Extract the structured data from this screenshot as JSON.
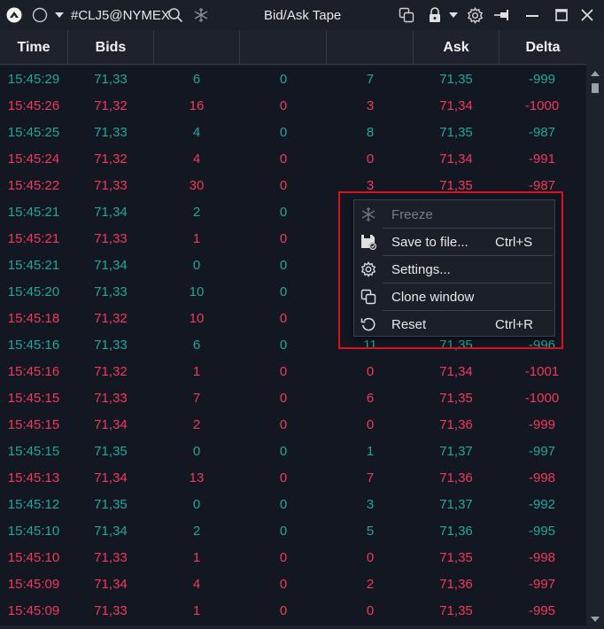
{
  "titlebar": {
    "symbol": "#CLJ5@NYMEX",
    "title": "Bid/Ask Tape"
  },
  "columns": [
    "Time",
    "Bids",
    "",
    "",
    "",
    "Ask",
    "Delta"
  ],
  "rows": [
    {
      "side": "buy",
      "cells": [
        "15:45:29",
        "71,33",
        "6",
        "0",
        "7",
        "71,35",
        "-999"
      ]
    },
    {
      "side": "sell",
      "cells": [
        "15:45:26",
        "71,32",
        "16",
        "0",
        "3",
        "71,34",
        "-1000"
      ]
    },
    {
      "side": "buy",
      "cells": [
        "15:45:25",
        "71,33",
        "4",
        "0",
        "8",
        "71,35",
        "-987"
      ]
    },
    {
      "side": "sell",
      "cells": [
        "15:45:24",
        "71,32",
        "4",
        "0",
        "0",
        "71,34",
        "-991"
      ]
    },
    {
      "side": "sell",
      "cells": [
        "15:45:22",
        "71,33",
        "30",
        "0",
        "3",
        "71,35",
        "-987"
      ]
    },
    {
      "side": "buy",
      "cells": [
        "15:45:21",
        "71,34",
        "2",
        "0",
        "",
        "",
        ""
      ]
    },
    {
      "side": "sell",
      "cells": [
        "15:45:21",
        "71,33",
        "1",
        "0",
        "",
        "",
        ""
      ]
    },
    {
      "side": "buy",
      "cells": [
        "15:45:21",
        "71,34",
        "0",
        "0",
        "",
        "",
        ""
      ]
    },
    {
      "side": "buy",
      "cells": [
        "15:45:20",
        "71,33",
        "10",
        "0",
        "",
        "",
        ""
      ]
    },
    {
      "side": "sell",
      "cells": [
        "15:45:18",
        "71,32",
        "10",
        "0",
        "",
        "",
        ""
      ]
    },
    {
      "side": "buy",
      "cells": [
        "15:45:16",
        "71,33",
        "6",
        "0",
        "11",
        "71,35",
        "-996"
      ]
    },
    {
      "side": "sell",
      "cells": [
        "15:45:16",
        "71,32",
        "1",
        "0",
        "0",
        "71,34",
        "-1001"
      ]
    },
    {
      "side": "sell",
      "cells": [
        "15:45:15",
        "71,33",
        "7",
        "0",
        "6",
        "71,35",
        "-1000"
      ]
    },
    {
      "side": "sell",
      "cells": [
        "15:45:15",
        "71,34",
        "2",
        "0",
        "0",
        "71,36",
        "-999"
      ]
    },
    {
      "side": "buy",
      "cells": [
        "15:45:15",
        "71,35",
        "0",
        "0",
        "1",
        "71,37",
        "-997"
      ]
    },
    {
      "side": "sell",
      "cells": [
        "15:45:13",
        "71,34",
        "13",
        "0",
        "7",
        "71,36",
        "-998"
      ]
    },
    {
      "side": "buy",
      "cells": [
        "15:45:12",
        "71,35",
        "0",
        "0",
        "3",
        "71,37",
        "-992"
      ]
    },
    {
      "side": "buy",
      "cells": [
        "15:45:10",
        "71,34",
        "2",
        "0",
        "5",
        "71,36",
        "-995"
      ]
    },
    {
      "side": "sell",
      "cells": [
        "15:45:10",
        "71,33",
        "1",
        "0",
        "0",
        "71,35",
        "-998"
      ]
    },
    {
      "side": "sell",
      "cells": [
        "15:45:09",
        "71,34",
        "4",
        "0",
        "2",
        "71,36",
        "-997"
      ]
    },
    {
      "side": "sell",
      "cells": [
        "15:45:09",
        "71,33",
        "1",
        "0",
        "0",
        "71,35",
        "-995"
      ]
    }
  ],
  "menu": {
    "items": [
      {
        "label": "Freeze",
        "shortcut": "",
        "icon": "snowflake-icon",
        "disabled": true
      },
      {
        "label": "Save to file...",
        "shortcut": "Ctrl+S",
        "icon": "save-file-icon",
        "disabled": false
      },
      {
        "label": "Settings...",
        "shortcut": "",
        "icon": "gear-icon",
        "disabled": false
      },
      {
        "label": "Clone window",
        "shortcut": "",
        "icon": "clone-icon",
        "disabled": false
      },
      {
        "label": "Reset",
        "shortcut": "Ctrl+R",
        "icon": "reset-icon",
        "disabled": false
      }
    ]
  },
  "colors": {
    "buy": "#26a69a",
    "sell": "#ef3b5a",
    "background": "#131722",
    "highlight_border": "#d6131e"
  }
}
